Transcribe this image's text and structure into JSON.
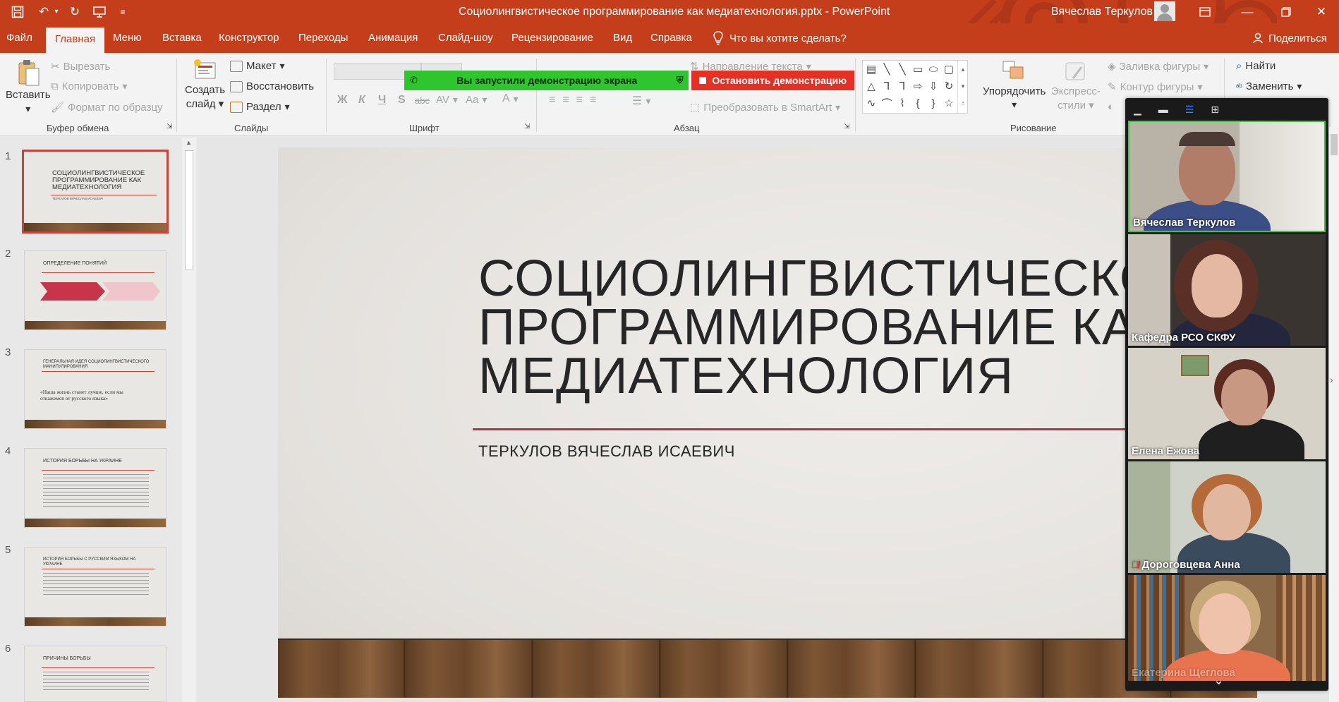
{
  "titlebar": {
    "title": "Социолингвистическое программирование как медиатехнология.pptx  -  PowerPoint",
    "user": "Вячеслав Теркулов",
    "accent": "#c43e1c"
  },
  "menu": {
    "tabs": [
      "Файл",
      "Главная",
      "Меню",
      "Вставка",
      "Конструктор",
      "Переходы",
      "Анимация",
      "Слайд-шоу",
      "Рецензирование",
      "Вид",
      "Справка"
    ],
    "active_tab": "Главная",
    "tell_me": "Что вы хотите сделать?",
    "share": "Поделиться"
  },
  "ribbon": {
    "clipboard": {
      "paste": "Вставить",
      "cut": "Вырезать",
      "copy": "Копировать",
      "format_painter": "Формат по образцу",
      "label": "Буфер обмена"
    },
    "slides": {
      "new_slide_1": "Создать",
      "new_slide_2": "слайд",
      "layout": "Макет",
      "reset": "Восстановить",
      "section": "Раздел",
      "label": "Слайды"
    },
    "font": {
      "label": "Шрифт",
      "bold": "Ж",
      "italic": "К",
      "underline": "Ч",
      "shadow": "S",
      "strike": "abc",
      "spacing": "AV",
      "case": "Aa",
      "color": "A"
    },
    "paragraph": {
      "label": "Абзац",
      "text_direction": "Направление текста",
      "convert_smartart": "Преобразовать в SmartArt"
    },
    "drawing": {
      "label": "Рисование",
      "arrange": "Упорядочить",
      "quick_styles_1": "Экспресс-",
      "quick_styles_2": "стили",
      "shape_fill": "Заливка фигуры",
      "shape_outline": "Контур фигуры"
    },
    "editing": {
      "find": "Найти",
      "replace": "Заменить"
    }
  },
  "share_banner": {
    "message": "Вы запустили демонстрацию экрана",
    "stop": "Остановить демонстрацию",
    "share_color": "#2ec52e",
    "stop_color": "#e63024"
  },
  "thumbnails": [
    {
      "num": "1",
      "title": "СОЦИОЛИНГВИСТИЧЕСКОЕ ПРОГРАММИРОВАНИЕ КАК МЕДИАТЕХНОЛОГИЯ",
      "sub": "ТЕРКУЛОВ ВЯЧЕСЛАВ ИСАЕВИЧ",
      "active": true
    },
    {
      "num": "2",
      "title": "ОПРЕДЕЛЕНИЕ ПОНЯТИЙ",
      "sub": ""
    },
    {
      "num": "3",
      "title": "ГЕНЕРАЛЬНАЯ ИДЕЯ СОЦИОЛИНГВИСТИЧЕСКОГО МАНИПУЛИРОВАНИЯ",
      "sub": "«Наша жизнь станет лучше, если мы откажемся от русского языка»"
    },
    {
      "num": "4",
      "title": "ИСТОРИЯ БОРЬБЫ НА УКРАИНЕ",
      "sub": ""
    },
    {
      "num": "5",
      "title": "ИСТОРИЯ БОРЬБЫ С РУССКИМ ЯЗЫКОМ НА УКРАИНЕ",
      "sub": ""
    },
    {
      "num": "6",
      "title": "ПРИЧИНЫ БОРЬБЫ",
      "sub": ""
    }
  ],
  "slide": {
    "title_line1": "СОЦИОЛИНГВИСТИЧЕСКОЕ",
    "title_line2": "ПРОГРАММИРОВАНИЕ КАК",
    "title_line3": "МЕДИАТЕХНОЛОГИЯ",
    "author": "ТЕРКУЛОВ ВЯЧЕСЛАВ ИСАЕВИЧ",
    "line_color": "#b82f3e"
  },
  "video_panel": {
    "participants": [
      {
        "name": "Вячеслав Теркулов",
        "muted": false
      },
      {
        "name": "Кафедра РСО СКФУ",
        "muted": false
      },
      {
        "name": "Елена Ежова",
        "muted": false
      },
      {
        "name": "Дороговцева Анна",
        "muted": true
      },
      {
        "name": "Екатерина Щеглова",
        "muted": false
      }
    ]
  }
}
